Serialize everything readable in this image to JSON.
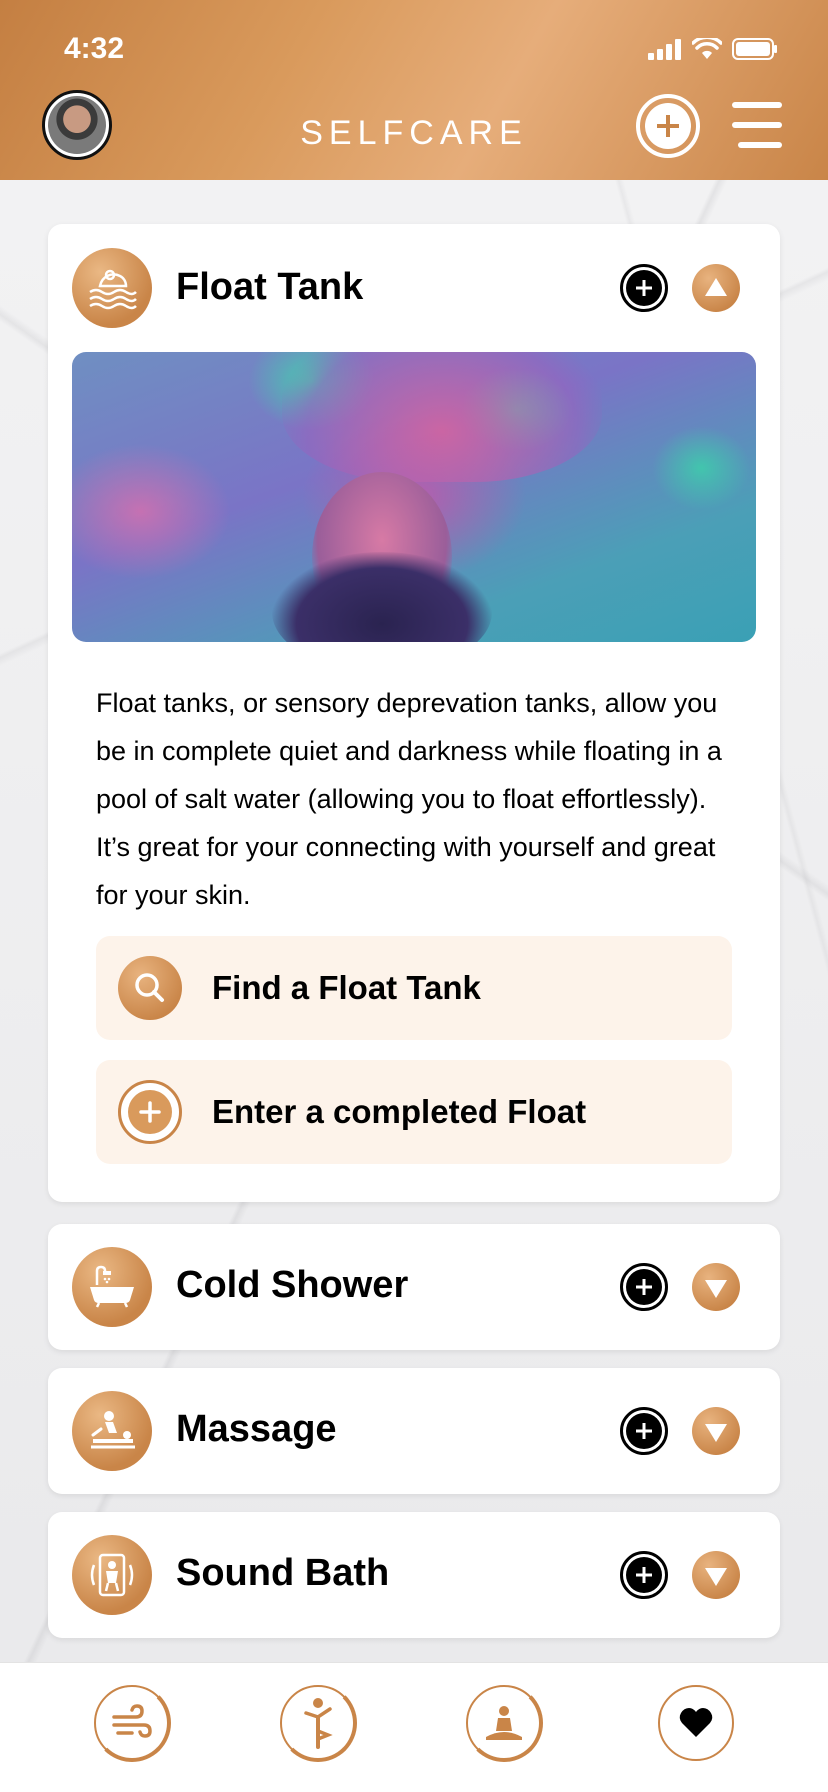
{
  "status_bar": {
    "time": "4:32"
  },
  "header": {
    "brand": "SELFCARE"
  },
  "colors": {
    "accent": "#c98548",
    "accent_light": "#fdf3ea",
    "text": "#000000"
  },
  "expanded_card": {
    "title": "Float Tank",
    "icon": "float-tank-icon",
    "description": "Float tanks, or sensory deprevation tanks, allow you be in complete quiet and darkness while floating in a pool of salt water (allowing you to float effortlessly). It’s great for your connecting with yourself and great for your skin.",
    "actions": [
      {
        "label": "Find a Float Tank",
        "icon": "search-icon"
      },
      {
        "label": "Enter a completed Float",
        "icon": "add-icon"
      }
    ]
  },
  "collapsed_cards": [
    {
      "title": "Cold Shower",
      "icon": "bathtub-icon"
    },
    {
      "title": "Massage",
      "icon": "massage-icon"
    },
    {
      "title": "Sound Bath",
      "icon": "sound-bath-icon"
    }
  ],
  "bottom_nav": [
    {
      "icon": "wind-icon"
    },
    {
      "icon": "yoga-pose-icon"
    },
    {
      "icon": "meditation-icon"
    },
    {
      "icon": "heart-icon"
    }
  ]
}
